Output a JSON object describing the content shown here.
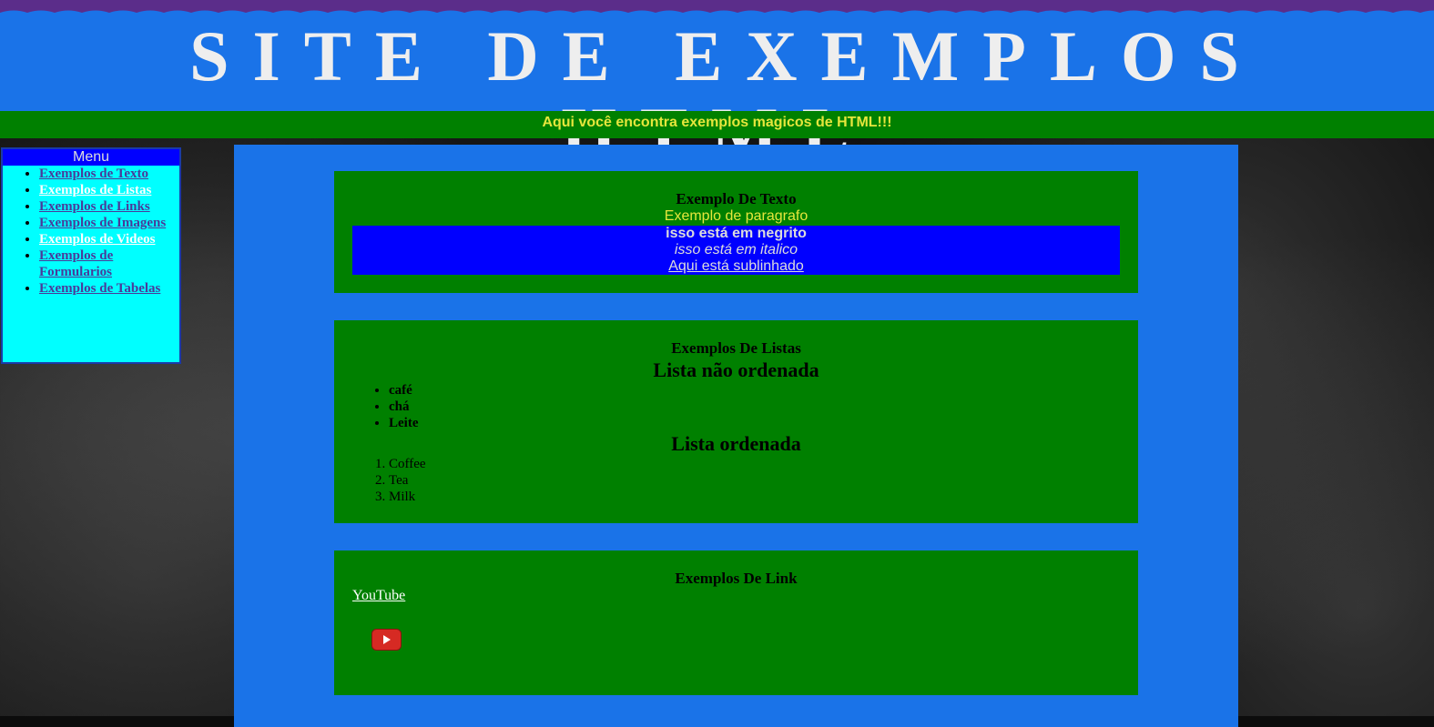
{
  "header": {
    "title": "SITE DE EXEMPLOS HTML",
    "tagline": "Aqui você encontra exemplos magicos de HTML!!!"
  },
  "menu": {
    "title": "Menu",
    "items": [
      {
        "label": "Exemplos de Texto"
      },
      {
        "label": "Exemplos de Listas"
      },
      {
        "label": "Exemplos de Links"
      },
      {
        "label": "Exemplos de Imagens"
      },
      {
        "label": "Exemplos de Videos"
      },
      {
        "label": "Exemplos de Formularios"
      },
      {
        "label": "Exemplos de Tabelas"
      }
    ]
  },
  "text_section": {
    "heading": "Exemplo De Texto",
    "paragraph": "Exemplo de paragrafo",
    "bold": "isso está em negrito",
    "italic": "isso está em italico",
    "underline": "Aqui está sublinhado"
  },
  "lists_section": {
    "heading": "Exemplos De Listas",
    "unordered_title": "Lista não ordenada",
    "unordered_items": [
      "café",
      "chá",
      "Leite"
    ],
    "ordered_title": "Lista ordenada",
    "ordered_items": [
      "Coffee",
      "Tea",
      "Milk"
    ]
  },
  "links_section": {
    "heading": "Exemplos De Link",
    "youtube_label": "YouTube",
    "youtube_icon": "youtube-icon"
  },
  "colors": {
    "header_blue": "#1a73e8",
    "tagline_green": "#008000",
    "tagline_text": "#e6e63c",
    "wave_purple": "#5b2d8a",
    "menu_cyan": "#00ffff",
    "menu_title_blue": "#0000ff",
    "card_green": "#008000",
    "highlight_blue": "#0000ff"
  }
}
